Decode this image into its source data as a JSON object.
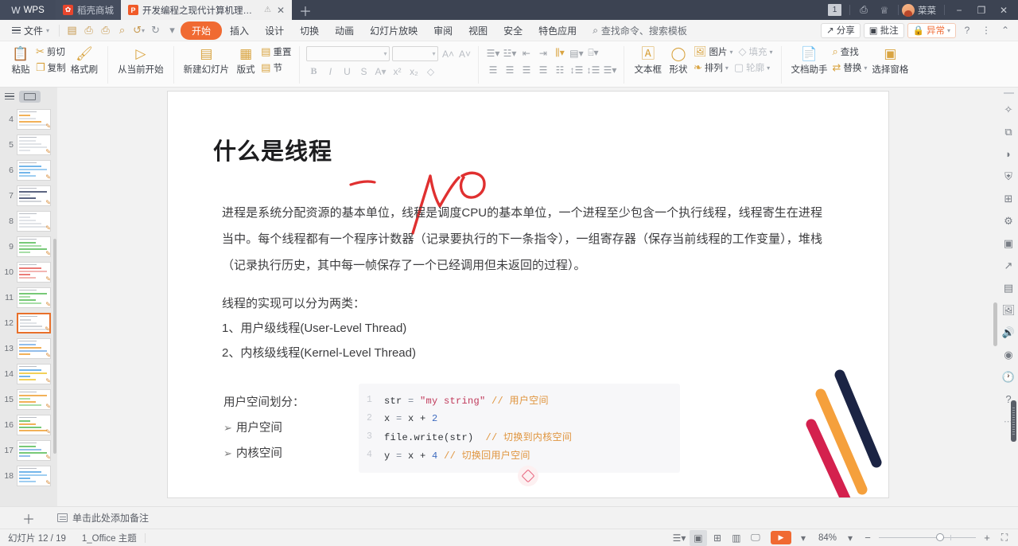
{
  "titlebar": {
    "brand": "WPS",
    "tabs": [
      {
        "label": "稻壳商城",
        "icon": "docer-icon",
        "active": false
      },
      {
        "label": "开发编程之现代计算机理论模型",
        "icon": "ppt-icon",
        "active": true
      }
    ],
    "new_tab_icon": "plus-icon",
    "badge_count": "1",
    "icons": [
      "backup-icon",
      "skin-icon"
    ],
    "user_name": "菜菜",
    "window_buttons": [
      "minimize-icon",
      "restore-icon",
      "close-icon"
    ]
  },
  "menubar": {
    "file_label": "文件",
    "quick_icons": [
      "save-icon",
      "print-preview-icon",
      "print-icon",
      "find-icon",
      "undo-icon",
      "redo-icon",
      "customize-icon"
    ],
    "tabs": [
      "开始",
      "插入",
      "设计",
      "切换",
      "动画",
      "幻灯片放映",
      "审阅",
      "视图",
      "安全",
      "特色应用"
    ],
    "active_tab": "开始",
    "search_placeholder": "查找命令、搜索模板",
    "share_label": "分享",
    "comment_label": "批注",
    "status_label": "异常",
    "help_icon": "question-icon",
    "more_icon": "more-icon",
    "collapse_icon": "chevron-up-icon"
  },
  "ribbon": {
    "clipboard": {
      "paste": "粘贴",
      "cut": "剪切",
      "copy": "复制",
      "format_painter": "格式刷"
    },
    "slideshow": {
      "from_current": "从当前开始"
    },
    "slides": {
      "new_slide": "新建幻灯片",
      "layout": "版式",
      "reset": "重置",
      "section": "节"
    },
    "font": {
      "name_value": "",
      "size_value": "",
      "grow_label": "A",
      "shrink_label": "A",
      "bold": "B",
      "italic": "I",
      "underline": "U",
      "strikethrough": "S",
      "font_color": "A",
      "superscript": "x²",
      "subscript": "x₂",
      "clear_format": "clear-format-icon"
    },
    "paragraph_icons": [
      "bullet-list-icon",
      "number-list-icon",
      "decrease-indent-icon",
      "increase-indent-icon",
      "text-direction-icon",
      "align-text-icon",
      "columns-icon",
      "align-left-icon",
      "align-center-icon",
      "align-right-icon",
      "justify-icon",
      "distribute-icon",
      "line-spacing-icon",
      "paragraph-spacing-icon",
      "list-level-icon"
    ],
    "insert": {
      "textbox": "文本框",
      "shape": "形状",
      "picture": "图片",
      "fill": "填充",
      "arrange": "排列",
      "outline": "轮廓"
    },
    "editing": {
      "doc_assistant": "文档助手",
      "find": "查找",
      "replace": "替换",
      "selection_pane": "选择窗格"
    }
  },
  "thumbnails": {
    "selected": 12,
    "items": [
      {
        "number": "4"
      },
      {
        "number": "5"
      },
      {
        "number": "6"
      },
      {
        "number": "7"
      },
      {
        "number": "8"
      },
      {
        "number": "9"
      },
      {
        "number": "10"
      },
      {
        "number": "11"
      },
      {
        "number": "12"
      },
      {
        "number": "13"
      },
      {
        "number": "14"
      },
      {
        "number": "15"
      },
      {
        "number": "16"
      },
      {
        "number": "17"
      },
      {
        "number": "18"
      }
    ]
  },
  "slide": {
    "title": "什么是线程",
    "paragraph": "进程是系统分配资源的基本单位，线程是调度CPU的基本单位，一个进程至少包含一个执行线程，线程寄生在进程当中。每个线程都有一个程序计数器（记录要执行的下一条指令），一组寄存器（保存当前线程的工作变量），堆栈（记录执行历史，其中每一帧保存了一个已经调用但未返回的过程）。",
    "impl_heading": "线程的实现可以分为两类：",
    "impl_item1": "1、用户级线程(User-Level Thread)",
    "impl_item2": "2、内核级线程(Kernel-Level Thread)",
    "space_heading": "用户空间划分：",
    "space_item1": "用户空间",
    "space_item2": "内核空间",
    "code": [
      {
        "no": "1",
        "var": "str",
        "op": " = ",
        "str": "\"my string\"",
        "tail": "",
        "comment": " // 用户空间"
      },
      {
        "no": "2",
        "var": "x",
        "op": " = ",
        "str": "x + ",
        "num": "2",
        "comment": ""
      },
      {
        "no": "3",
        "var": "file.write(str)",
        "op": "",
        "str": "",
        "comment": "  // 切换到内核空间"
      },
      {
        "no": "4",
        "var": "y",
        "op": " = ",
        "str": "x + ",
        "num": "4",
        "comment": " // 切换回用户空间"
      }
    ]
  },
  "rail_icons": [
    "star-effects-icon",
    "swap-icon",
    "shape-icon",
    "watermark-icon",
    "grid-icon",
    "settings-sliders-icon",
    "image-library-icon",
    "export-icon",
    "box-icon",
    "picture-icon",
    "sound-icon",
    "record-icon",
    "history-icon",
    "help-circle-icon"
  ],
  "notes": {
    "placeholder": "单击此处添加备注",
    "add_slide_icon": "plus-icon"
  },
  "status": {
    "slide_counter": "幻灯片 12 / 19",
    "theme": "1_Office 主题",
    "view_icons": [
      "outline-view-icon",
      "normal-view-icon",
      "slide-sorter-icon",
      "reading-view-icon",
      "presenter-view-icon"
    ],
    "play_label": "play-icon",
    "zoom_level": "84%",
    "zoom_out": "−",
    "zoom_in": "+",
    "fit_icon": "fit-to-window-icon"
  },
  "colors": {
    "accent_orange": "#f06a32",
    "titlebar_bg": "#3c4352",
    "ribbon_gold": "#d9a441",
    "code_string": "#c0395a",
    "code_comment": "#e0953f",
    "ink_red": "#e03030"
  }
}
